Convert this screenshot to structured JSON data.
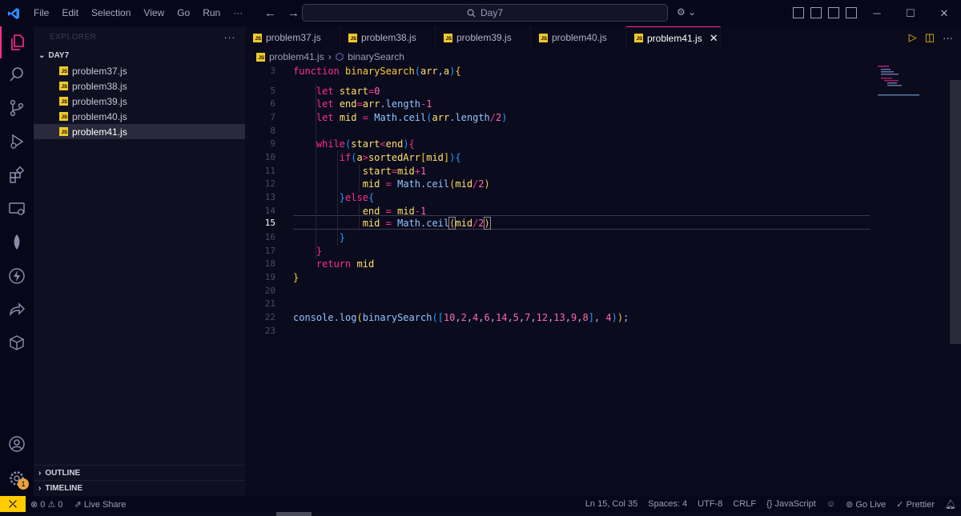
{
  "menu": [
    "File",
    "Edit",
    "Selection",
    "View",
    "Go",
    "Run",
    "···"
  ],
  "search": {
    "label": "Day7"
  },
  "sidebar": {
    "header": "EXPLORER",
    "more": "···",
    "folder": "DAY7",
    "files": [
      "problem37.js",
      "problem38.js",
      "problem39.js",
      "problem40.js",
      "problem41.js"
    ],
    "selected": "problem41.js",
    "outline": "OUTLINE",
    "timeline": "TIMELINE"
  },
  "tabs": [
    "problem37.js",
    "problem38.js",
    "problem39.js",
    "problem40.js",
    "problem41.js"
  ],
  "active_tab": "problem41.js",
  "breadcrumb": {
    "file": "problem41.js",
    "symbol": "binarySearch"
  },
  "code_lines": [
    {
      "n": "3",
      "text": "function binarySearch(arr,a){"
    },
    {
      "n": "5",
      "text": "    let start=0"
    },
    {
      "n": "6",
      "text": "    let end=arr.length-1"
    },
    {
      "n": "7",
      "text": "    let mid = Math.ceil(arr.length/2)"
    },
    {
      "n": "8",
      "text": ""
    },
    {
      "n": "9",
      "text": "    while(start<end){"
    },
    {
      "n": "10",
      "text": "        if(a>sortedArr[mid]){"
    },
    {
      "n": "11",
      "text": "            start=mid+1"
    },
    {
      "n": "12",
      "text": "            mid = Math.ceil(mid/2)"
    },
    {
      "n": "13",
      "text": "        }else{"
    },
    {
      "n": "14",
      "text": "            end = mid-1"
    },
    {
      "n": "15",
      "text": "            mid = Math.ceil(mid/2)"
    },
    {
      "n": "16",
      "text": "        }"
    },
    {
      "n": "17",
      "text": "    }"
    },
    {
      "n": "18",
      "text": "    return mid"
    },
    {
      "n": "19",
      "text": "}"
    },
    {
      "n": "20",
      "text": ""
    },
    {
      "n": "21",
      "text": ""
    },
    {
      "n": "22",
      "text": "console.log(binarySearch([10,2,4,6,14,5,7,12,13,9,8], 4));"
    },
    {
      "n": "23",
      "text": ""
    }
  ],
  "current_line": "15",
  "status": {
    "errors": "0",
    "warnings": "0",
    "live_share": "Live Share",
    "position": "Ln 15, Col 35",
    "spaces": "Spaces: 4",
    "encoding": "UTF-8",
    "eol": "CRLF",
    "language": "JavaScript",
    "go_live": "Go Live",
    "prettier": "Prettier",
    "badge": "1"
  },
  "colors": {
    "accent": "#ff2e88",
    "js_icon": "#f0c92b",
    "remote": "#ffcc00",
    "background": "#0b0b1e"
  }
}
